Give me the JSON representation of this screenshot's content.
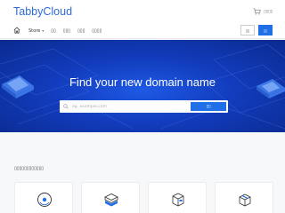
{
  "header": {
    "brand": "TabbyCloud",
    "util_label": "▯▯▯▯",
    "cart_icon": "cart-icon"
  },
  "nav": {
    "home_icon": "home-icon",
    "items": [
      {
        "label": "Store",
        "has_dropdown": true
      },
      {
        "label": "▯▯"
      },
      {
        "label": "▯▯▯"
      },
      {
        "label": "▯▯▯"
      },
      {
        "label": "▯▯▯▯"
      }
    ],
    "login_label": "▯▯",
    "signup_label": "▯▯"
  },
  "hero": {
    "title": "Find your new domain name",
    "search_placeholder": "eg. example.com",
    "search_button": "▯▯",
    "colors": {
      "bg": "#1646d0",
      "accent": "#1f6fe8"
    }
  },
  "products": {
    "heading": "▯▯▯▯▯▯▯▯▯▯▯▯",
    "cards": [
      {
        "icon": "disc-icon"
      },
      {
        "icon": "server-stack-icon"
      },
      {
        "icon": "box-icon"
      },
      {
        "icon": "package-icon"
      }
    ]
  }
}
